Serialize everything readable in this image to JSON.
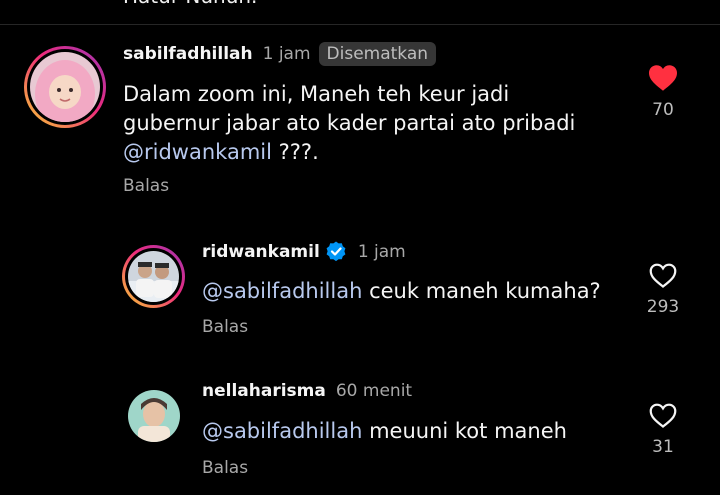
{
  "top_cut_text": "Hatur Nuhun.",
  "comments": [
    {
      "username": "sabilfadhillah",
      "time": "1 jam",
      "pinned_label": "Disematkan",
      "text_lines": [
        "Dalam zoom ini, Maneh teh keur jadi",
        "gubernur jabar ato kader partai ato pribadi"
      ],
      "mention": "@ridwankamil",
      "text_tail": " ???.",
      "reply_label": "Balas",
      "like_count": "70",
      "liked": true
    },
    {
      "username": "ridwankamil",
      "verified": true,
      "time": "1 jam",
      "mention": "@sabilfadhillah",
      "text_tail": " ceuk maneh kumaha?",
      "reply_label": "Balas",
      "like_count": "293",
      "liked": false
    },
    {
      "username": "nellaharisma",
      "time": "60 menit",
      "mention": "@sabilfadhillah",
      "text_tail": " meuuni kot maneh",
      "reply_label": "Balas",
      "like_count": "31",
      "liked": false
    }
  ],
  "colors": {
    "background": "#000000",
    "heart_liked": "#ff3040",
    "mention": "#b8c9ee",
    "verified": "#0095f6"
  },
  "icons": {
    "liked": "heart-filled-icon",
    "unliked": "heart-outline-icon",
    "verified": "verified-badge-icon"
  }
}
